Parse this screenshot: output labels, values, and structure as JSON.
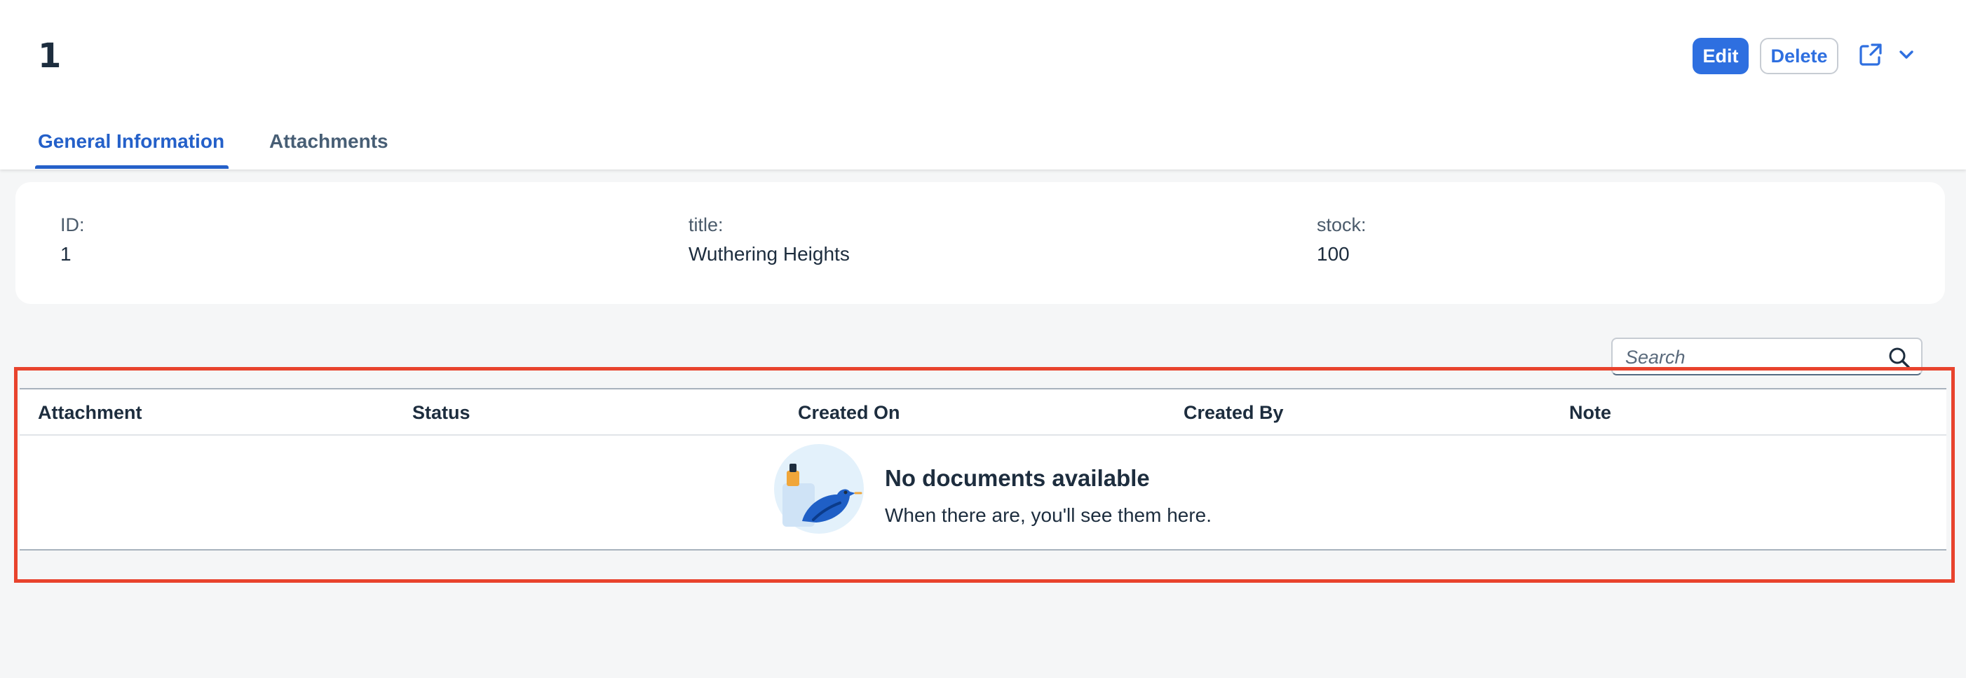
{
  "page": {
    "title": "1"
  },
  "toolbar": {
    "edit_label": "Edit",
    "delete_label": "Delete",
    "share_icon": "share-icon",
    "menu_icon": "chevron-down-icon"
  },
  "tabs": [
    {
      "label": "General Information",
      "selected": true
    },
    {
      "label": "Attachments",
      "selected": false
    }
  ],
  "fields": {
    "id": {
      "label": "ID:",
      "value": "1"
    },
    "title": {
      "label": "title:",
      "value": "Wuthering Heights"
    },
    "stock": {
      "label": "stock:",
      "value": "100"
    }
  },
  "search": {
    "placeholder": "Search",
    "value": ""
  },
  "table": {
    "columns": [
      "Attachment",
      "Status",
      "Created On",
      "Created By",
      "Note"
    ],
    "rows": [],
    "empty_title": "No documents available",
    "empty_subtitle": "When there are, you'll see them here."
  },
  "colors": {
    "accent": "#2e6fe0",
    "highlight_border": "#e8432d",
    "background": "#f5f6f7"
  }
}
